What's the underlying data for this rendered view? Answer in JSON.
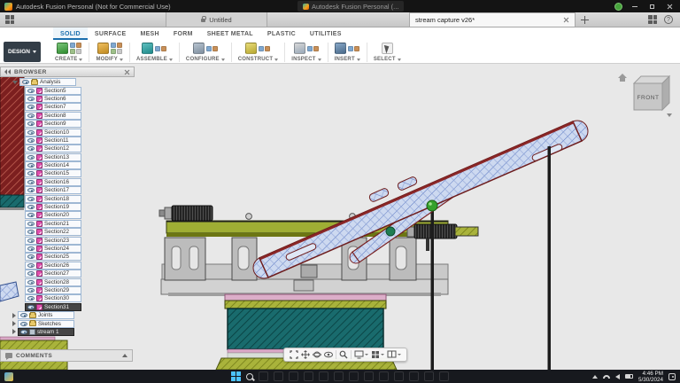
{
  "theme": {
    "accent-blue": "#1b6fae",
    "fusion-orange": "#f04e23",
    "model-olive": "#9fae34",
    "model-teal": "#196b6d",
    "model-maroon": "#7c1f1f",
    "model-hatch-blue": "#5b79c4",
    "highlight-green": "#35a12c"
  },
  "title_bar": {
    "app_title": "Autodesk Fusion Personal (Not for Commercial Use)",
    "window_group_title": "Autodesk Fusion Personal (..."
  },
  "tab_bar": {
    "document_tab": "Untitled",
    "active_tab": "stream capture v26*",
    "help_glyph": "?"
  },
  "ribbon": {
    "design_label": "DESIGN",
    "tabs": [
      {
        "label": "SOLID",
        "selected": true
      },
      {
        "label": "SURFACE"
      },
      {
        "label": "MESH"
      },
      {
        "label": "FORM"
      },
      {
        "label": "SHEET METAL"
      },
      {
        "label": "PLASTIC"
      },
      {
        "label": "UTILITIES"
      }
    ],
    "groups": [
      {
        "label": "CREATE"
      },
      {
        "label": "MODIFY"
      },
      {
        "label": "ASSEMBLE"
      },
      {
        "label": "CONFIGURE"
      },
      {
        "label": "CONSTRUCT"
      },
      {
        "label": "INSPECT"
      },
      {
        "label": "INSERT"
      },
      {
        "label": "SELECT"
      }
    ]
  },
  "browser": {
    "title": "BROWSER",
    "analysis_label": "Analysis",
    "sections": [
      {
        "label": "Section5"
      },
      {
        "label": "Section6"
      },
      {
        "label": "Section7"
      },
      {
        "label": "Section8"
      },
      {
        "label": "Section9"
      },
      {
        "label": "Section10"
      },
      {
        "label": "Section11"
      },
      {
        "label": "Section12"
      },
      {
        "label": "Section13"
      },
      {
        "label": "Section14"
      },
      {
        "label": "Section15"
      },
      {
        "label": "Section16"
      },
      {
        "label": "Section17"
      },
      {
        "label": "Section18"
      },
      {
        "label": "Section19"
      },
      {
        "label": "Section20"
      },
      {
        "label": "Section21"
      },
      {
        "label": "Section22"
      },
      {
        "label": "Section23"
      },
      {
        "label": "Section24"
      },
      {
        "label": "Section25"
      },
      {
        "label": "Section26"
      },
      {
        "label": "Section27"
      },
      {
        "label": "Section28"
      },
      {
        "label": "Section29"
      },
      {
        "label": "Section30"
      },
      {
        "label": "Section31",
        "selected": true
      }
    ],
    "joints_label": "Joints",
    "sketches_label": "Sketches",
    "stream_label": "stream 1"
  },
  "viewcube": {
    "front": "FRONT"
  },
  "navbar": {
    "icons": [
      "zoom-fit",
      "pan",
      "orbit",
      "look-at",
      "zoom",
      "display-settings",
      "grid-display",
      "viewports"
    ]
  },
  "comments": {
    "label": "COMMENTS"
  },
  "taskbar": {
    "time": "4:46 PM",
    "date": "5/30/2024",
    "apps": [
      {
        "name": "task-view",
        "color": "#8fb4d9"
      },
      {
        "name": "file-explorer",
        "color": "#f2c13d"
      },
      {
        "name": "edge",
        "color": "#35a3d8"
      },
      {
        "name": "chrome",
        "color": "#e4e4e4"
      },
      {
        "name": "discord",
        "color": "#5865f2"
      },
      {
        "name": "steam",
        "color": "#2a3f5f"
      },
      {
        "name": "spotify",
        "color": "#1db954"
      },
      {
        "name": "obs-studio",
        "color": "#3d3d3d"
      },
      {
        "name": "fusion-360",
        "color": "#f04e23"
      },
      {
        "name": "blender",
        "color": "#e87d0d"
      },
      {
        "name": "terminal",
        "color": "#1f2a44"
      },
      {
        "name": "vlc",
        "color": "#e85e00"
      },
      {
        "name": "settings",
        "color": "#9aa0a8"
      }
    ]
  }
}
